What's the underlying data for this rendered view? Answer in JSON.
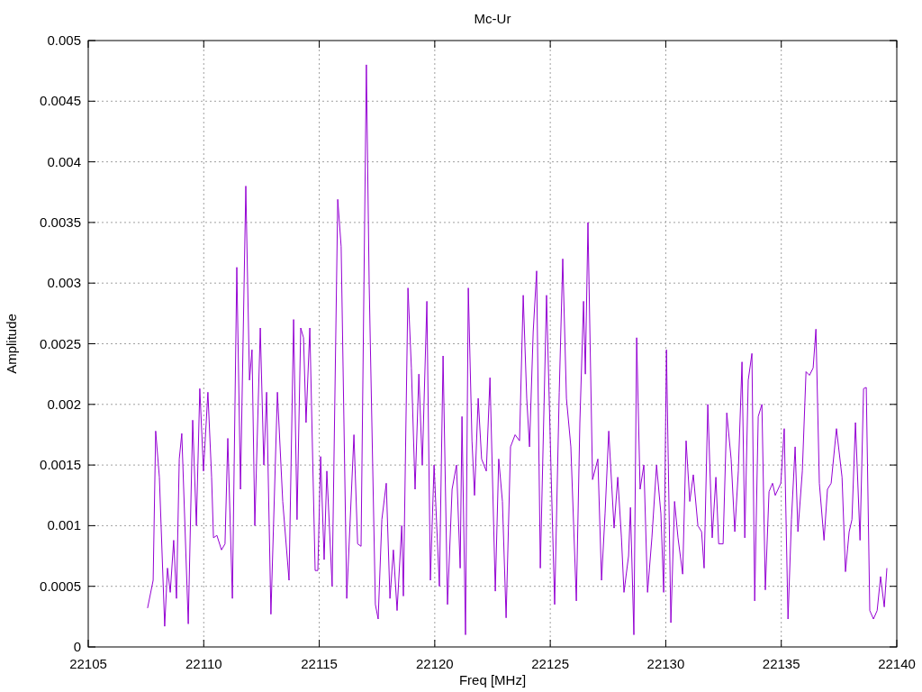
{
  "chart_data": {
    "type": "line",
    "title": "Mc-Ur",
    "grid": true,
    "xlabel": "Freq [MHz]",
    "ylabel": "Amplitude",
    "xlim": [
      22105,
      22140
    ],
    "ylim": [
      0,
      0.005
    ],
    "xticks": [
      22105,
      22110,
      22115,
      22120,
      22125,
      22130,
      22135,
      22140
    ],
    "yticks": [
      0,
      0.0005,
      0.001,
      0.0015,
      0.002,
      0.0025,
      0.003,
      0.0035,
      0.004,
      0.0045,
      0.005
    ],
    "x": [
      22107.57,
      22107.81,
      22107.92,
      22108.08,
      22108.31,
      22108.43,
      22108.55,
      22108.7,
      22108.82,
      22108.94,
      22109.05,
      22109.33,
      22109.52,
      22109.68,
      22109.83,
      22109.99,
      22110.18,
      22110.34,
      22110.42,
      22110.57,
      22110.77,
      22110.92,
      22111.04,
      22111.24,
      22111.43,
      22111.59,
      22111.82,
      22111.98,
      22112.09,
      22112.21,
      22112.45,
      22112.6,
      22112.72,
      22112.91,
      22113.19,
      22113.42,
      22113.69,
      22113.89,
      22114.04,
      22114.2,
      22114.32,
      22114.43,
      22114.59,
      22114.82,
      22114.94,
      22115.06,
      22115.21,
      22115.33,
      22115.56,
      22115.8,
      22115.95,
      22116.19,
      22116.5,
      22116.66,
      22116.81,
      22117.04,
      22117.16,
      22117.43,
      22117.55,
      22117.71,
      22117.9,
      22118.06,
      22118.21,
      22118.37,
      22118.57,
      22118.64,
      22118.84,
      22118.99,
      22119.15,
      22119.31,
      22119.46,
      22119.66,
      22119.81,
      22119.97,
      22120.2,
      22120.36,
      22120.55,
      22120.75,
      22120.94,
      22121.1,
      22121.18,
      22121.33,
      22121.45,
      22121.61,
      22121.72,
      22121.88,
      22122.03,
      22122.23,
      22122.39,
      22122.62,
      22122.77,
      22122.93,
      22123.09,
      22123.28,
      22123.48,
      22123.67,
      22123.83,
      22123.98,
      22124.1,
      22124.26,
      22124.41,
      22124.57,
      22124.84,
      22125.04,
      22125.19,
      22125.39,
      22125.54,
      22125.7,
      22125.89,
      22126.13,
      22126.28,
      22126.44,
      22126.52,
      22126.63,
      22126.83,
      22127.06,
      22127.22,
      22127.37,
      22127.53,
      22127.76,
      22127.92,
      22128.08,
      22128.19,
      22128.39,
      22128.47,
      22128.62,
      22128.74,
      22128.89,
      22129.05,
      22129.21,
      22129.4,
      22129.6,
      22129.79,
      22129.91,
      22130.03,
      22130.22,
      22130.38,
      22130.53,
      22130.73,
      22130.88,
      22131.04,
      22131.19,
      22131.39,
      22131.55,
      22131.66,
      22131.82,
      22132.01,
      22132.17,
      22132.29,
      22132.48,
      22132.64,
      22132.83,
      22132.99,
      22133.14,
      22133.3,
      22133.42,
      22133.57,
      22133.73,
      22133.85,
      22134.0,
      22134.16,
      22134.31,
      22134.47,
      22134.62,
      22134.74,
      22134.98,
      22135.13,
      22135.29,
      22135.44,
      22135.6,
      22135.72,
      22135.91,
      22136.07,
      22136.22,
      22136.38,
      22136.5,
      22136.65,
      22136.85,
      22137.0,
      22137.16,
      22137.39,
      22137.63,
      22137.78,
      22137.94,
      22138.06,
      22138.21,
      22138.41,
      22138.56,
      22138.68,
      22138.83,
      22138.99,
      22139.15,
      22139.3,
      22139.46,
      22139.57
    ],
    "series": [
      {
        "color": "#9400d3",
        "values": [
          0.00032,
          0.00055,
          0.00178,
          0.0014,
          0.00017,
          0.00065,
          0.00045,
          0.00088,
          0.0004,
          0.00155,
          0.00176,
          0.00019,
          0.00187,
          0.001,
          0.00213,
          0.00145,
          0.0021,
          0.0014,
          0.0009,
          0.00092,
          0.0008,
          0.00085,
          0.00172,
          0.0004,
          0.00313,
          0.0013,
          0.0038,
          0.0022,
          0.00245,
          0.001,
          0.00263,
          0.0015,
          0.0021,
          0.00027,
          0.0021,
          0.0012,
          0.00055,
          0.0027,
          0.00105,
          0.00263,
          0.00255,
          0.00185,
          0.00263,
          0.00063,
          0.00063,
          0.00157,
          0.00072,
          0.00145,
          0.0005,
          0.00369,
          0.0033,
          0.0004,
          0.00175,
          0.00085,
          0.00083,
          0.0048,
          0.003,
          0.00035,
          0.00023,
          0.00105,
          0.00135,
          0.0004,
          0.0008,
          0.0003,
          0.001,
          0.00042,
          0.00296,
          0.0023,
          0.0013,
          0.00225,
          0.0015,
          0.00285,
          0.00055,
          0.0015,
          0.0005,
          0.0024,
          0.00035,
          0.0013,
          0.0015,
          0.00065,
          0.0019,
          0.0001,
          0.00296,
          0.0017,
          0.00125,
          0.00205,
          0.00155,
          0.00145,
          0.00222,
          0.00046,
          0.00155,
          0.0012,
          0.00024,
          0.00165,
          0.00175,
          0.0017,
          0.0029,
          0.00205,
          0.00165,
          0.0026,
          0.0031,
          0.00065,
          0.0029,
          0.0014,
          0.00035,
          0.0021,
          0.0032,
          0.00205,
          0.00165,
          0.00038,
          0.00185,
          0.00285,
          0.00225,
          0.0035,
          0.00138,
          0.00155,
          0.00055,
          0.0011,
          0.00178,
          0.00098,
          0.0014,
          0.0009,
          0.00045,
          0.00075,
          0.00115,
          0.0001,
          0.00255,
          0.0013,
          0.0015,
          0.00045,
          0.0009,
          0.0015,
          0.0011,
          0.00045,
          0.00245,
          0.0002,
          0.0012,
          0.0009,
          0.0006,
          0.0017,
          0.0012,
          0.00142,
          0.001,
          0.00095,
          0.00065,
          0.002,
          0.0009,
          0.0014,
          0.00085,
          0.00085,
          0.00193,
          0.00155,
          0.00095,
          0.00145,
          0.00235,
          0.0009,
          0.0022,
          0.00242,
          0.00038,
          0.0019,
          0.002,
          0.00047,
          0.00128,
          0.00135,
          0.00125,
          0.00135,
          0.0018,
          0.00023,
          0.00105,
          0.00165,
          0.00095,
          0.00145,
          0.00227,
          0.00224,
          0.0023,
          0.00262,
          0.00135,
          0.00088,
          0.0013,
          0.00135,
          0.0018,
          0.0014,
          0.00062,
          0.00095,
          0.00105,
          0.00185,
          0.00088,
          0.00213,
          0.00214,
          0.0003,
          0.00023,
          0.0003,
          0.00058,
          0.00033,
          0.00065
        ]
      }
    ]
  }
}
